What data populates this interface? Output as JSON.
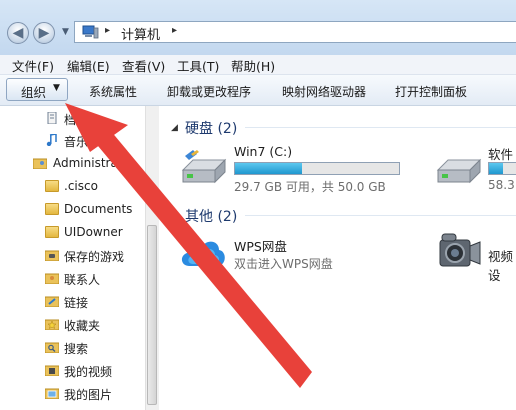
{
  "address": {
    "location": "计算机"
  },
  "menu": [
    "文件(F)",
    "编辑(E)",
    "查看(V)",
    "工具(T)",
    "帮助(H)"
  ],
  "toolbar": {
    "organize": "组织",
    "buttons": [
      "系统属性",
      "卸载或更改程序",
      "映射网络驱动器",
      "打开控制面板"
    ]
  },
  "nav": {
    "items": [
      {
        "label": "档",
        "icon": "document-icon"
      },
      {
        "label": "音乐",
        "icon": "music-icon"
      },
      {
        "label": "Administrator",
        "icon": "user-folder-icon"
      },
      {
        "label": ".cisco",
        "icon": "folder-icon"
      },
      {
        "label": "Documents",
        "icon": "folder-icon"
      },
      {
        "label": "UIDowner",
        "icon": "folder-icon"
      },
      {
        "label": "保存的游戏",
        "icon": "games-folder-icon"
      },
      {
        "label": "联系人",
        "icon": "contacts-folder-icon"
      },
      {
        "label": "链接",
        "icon": "links-folder-icon"
      },
      {
        "label": "收藏夹",
        "icon": "favorites-folder-icon"
      },
      {
        "label": "搜索",
        "icon": "search-folder-icon"
      },
      {
        "label": "我的视频",
        "icon": "videos-folder-icon"
      },
      {
        "label": "我的图片",
        "icon": "pictures-folder-icon"
      }
    ]
  },
  "content": {
    "hard_disks": {
      "title": "硬盘 (2)",
      "drives": [
        {
          "name": "Win7 (C:)",
          "space": "29.7 GB 可用，共 50.0 GB",
          "used_fraction": 0.41
        },
        {
          "name": "软件",
          "space": "58.3",
          "used_fraction": 0.5
        }
      ]
    },
    "other": {
      "title": "其他 (2)",
      "items": [
        {
          "name": "WPS网盘",
          "desc": "双击进入WPS网盘"
        },
        {
          "name": "视频设"
        }
      ]
    }
  },
  "colors": {
    "annotation_arrow": "#e8413a",
    "accent": "#1f97cf"
  }
}
